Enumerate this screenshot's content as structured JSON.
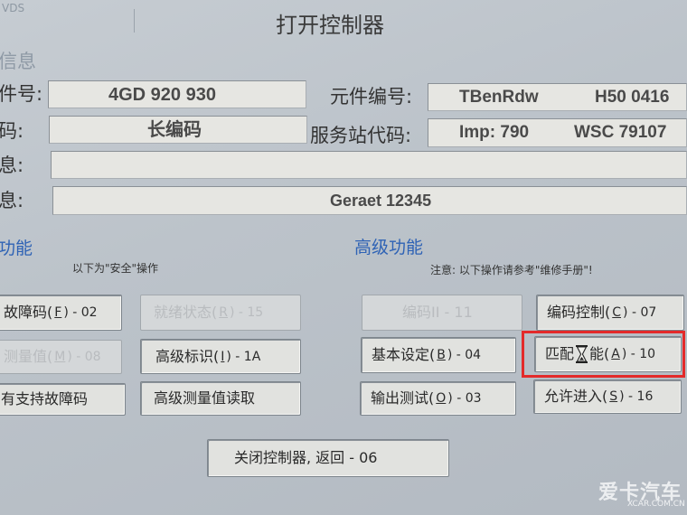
{
  "window": {
    "app_tag": "VDS",
    "title": "打开控制器"
  },
  "info": {
    "section_label": "信息",
    "part_no_label": "件号:",
    "part_no_value": "4GD 920 930",
    "component_label": "元件编号:",
    "component_value_1": "TBenRdw",
    "component_value_2": "H50 0416",
    "coding_label": "码:",
    "coding_value": "长编码",
    "dealer_label": "服务站代码:",
    "dealer_imp": "Imp: 790",
    "dealer_wsc": "WSC 79107",
    "extra_label": "息:",
    "extra_value": "",
    "extra2_label": "息:",
    "extra2_value": "Geraet 12345"
  },
  "sections": {
    "basic_title": "功能",
    "basic_note": "以下为\"安全\"操作",
    "advanced_title": "高级功能",
    "advanced_note": "注意: 以下操作请参考\"维修手册\"!"
  },
  "buttons": {
    "fault_codes": {
      "label": "故障码(",
      "key": "F",
      "suffix": ") - 02"
    },
    "readiness": {
      "label": "就绪状态(",
      "key": "R",
      "suffix": ") - 15"
    },
    "coding2": {
      "label": "编码II - 11"
    },
    "coding_ctrl": {
      "label": "编码控制(",
      "key": "C",
      "suffix": ") - 07"
    },
    "meas_values": {
      "label": "测量值(",
      "key": "M",
      "suffix": ") - 08"
    },
    "adv_ident": {
      "label": "高级标识(",
      "key": "I",
      "suffix": ") - 1A"
    },
    "basic_setting": {
      "label": "基本设定(",
      "key": "B",
      "suffix": ") - 04"
    },
    "adaptation": {
      "label1": "匹配",
      "label2": "能(",
      "key": "A",
      "suffix": ") - 10"
    },
    "supported_codes": {
      "label": "有支持故障码"
    },
    "adv_meas_read": {
      "label": "高级测量值读取"
    },
    "output_test": {
      "label": "输出测试(",
      "key": "O",
      "suffix": ") - 03"
    },
    "access": {
      "label": "允许进入(",
      "key": "S",
      "suffix": ") - 16"
    },
    "close": {
      "label": "关闭控制器, 返回 - 06"
    }
  },
  "watermark": {
    "brand": "爱卡汽车",
    "url": "XCAR.COM.CN"
  }
}
